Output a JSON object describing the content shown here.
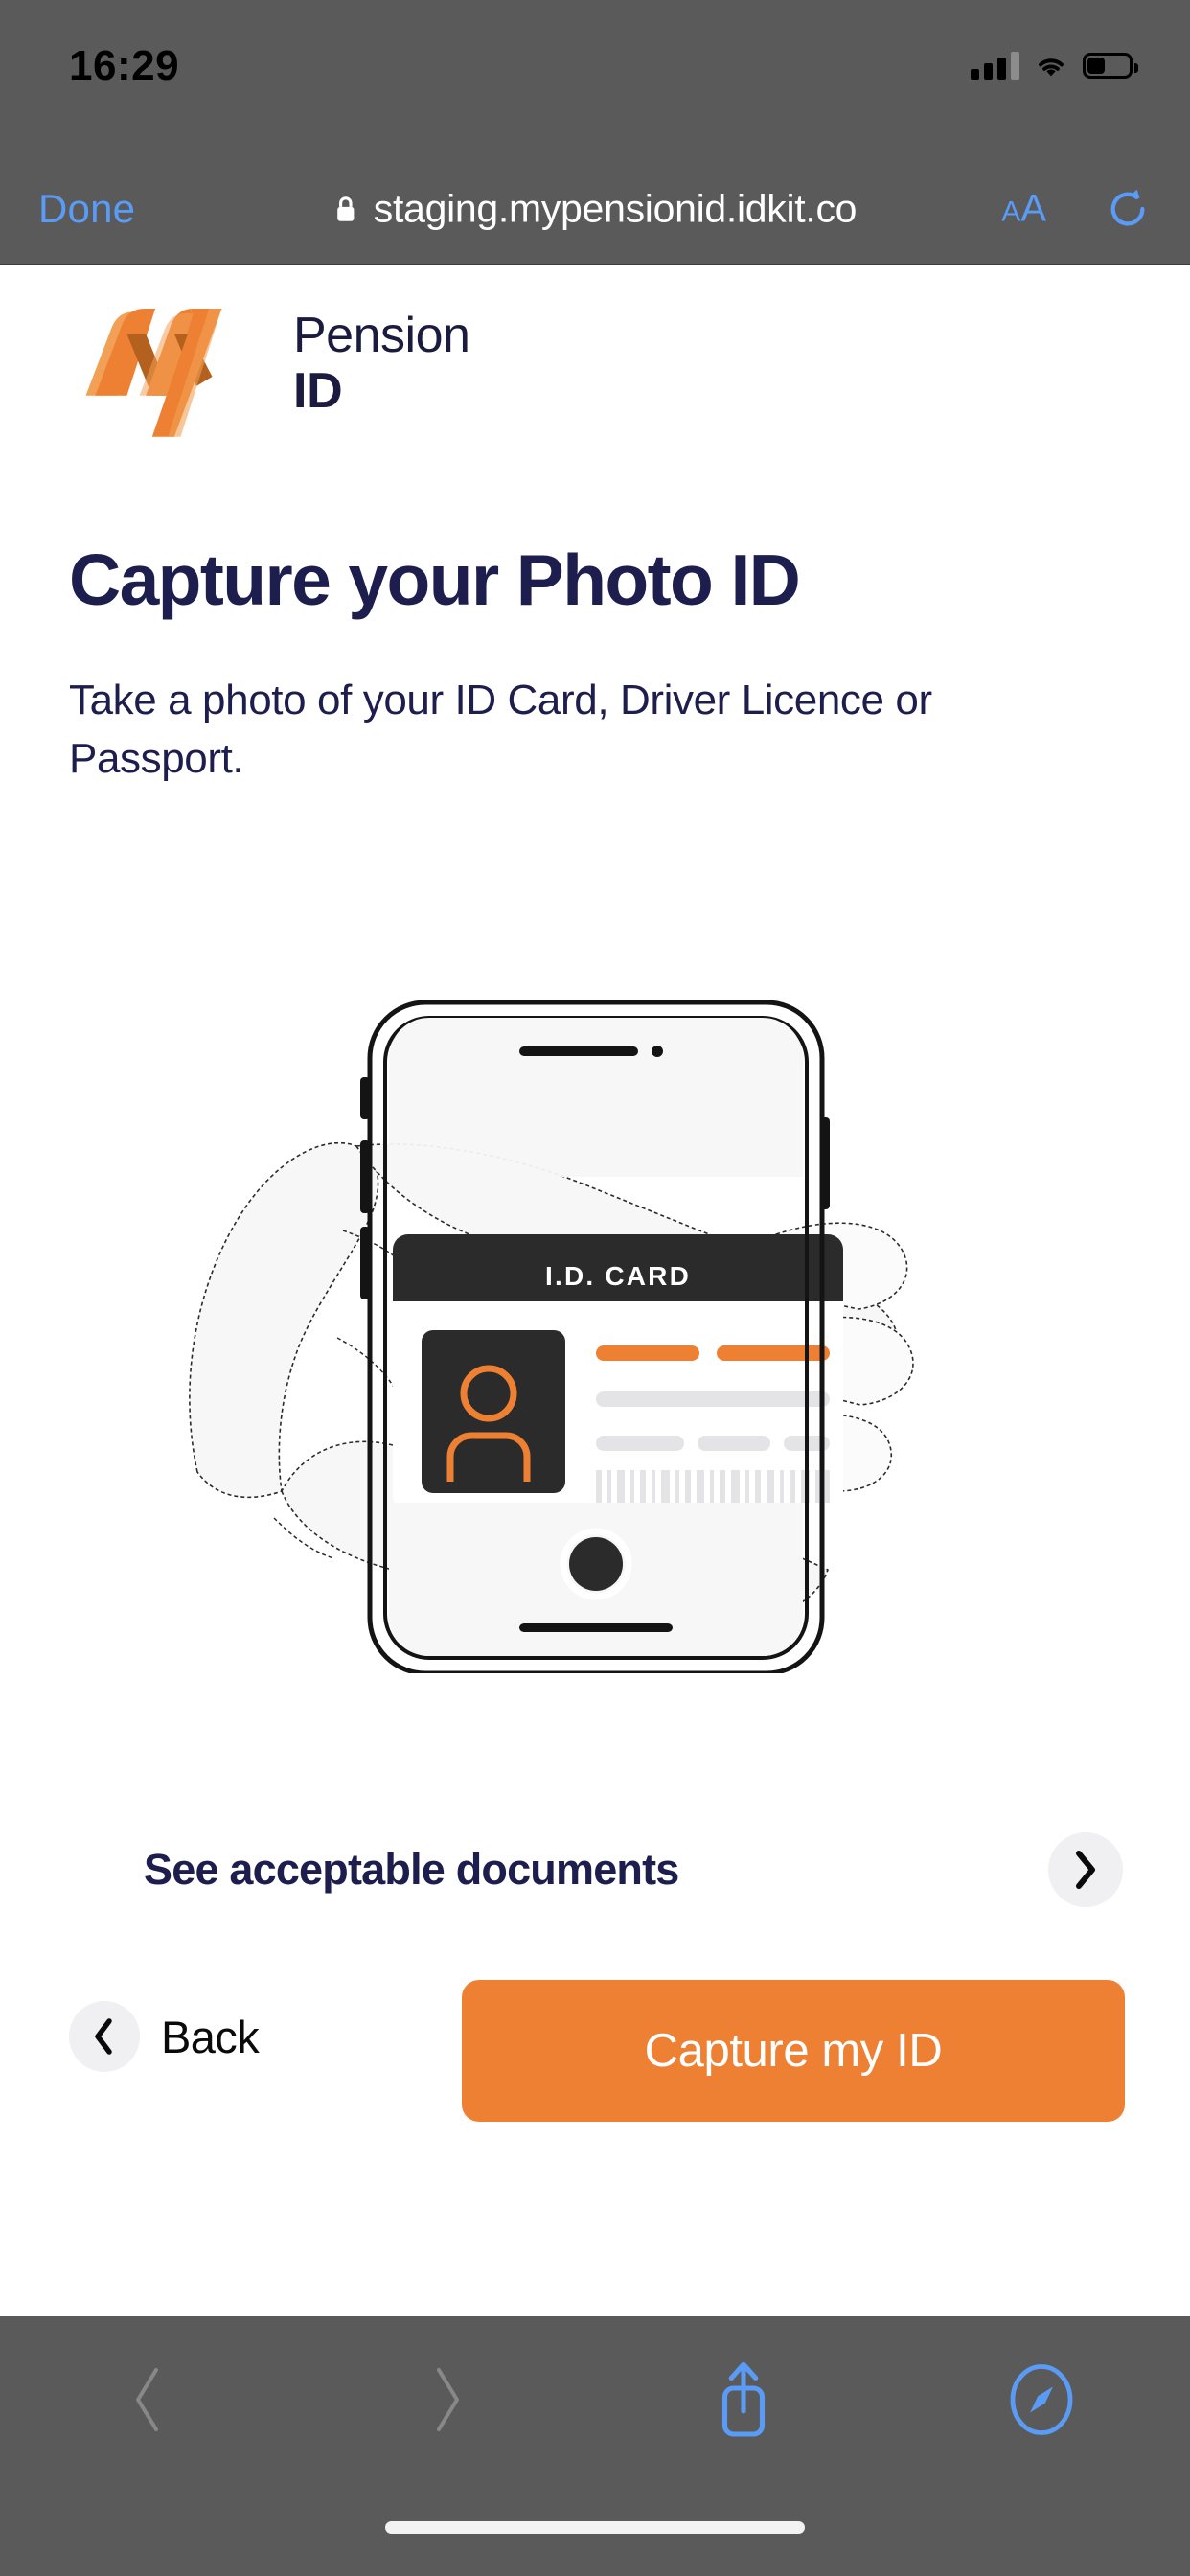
{
  "status_bar": {
    "time": "16:29",
    "signal_icon": "cellular-signal-icon",
    "wifi_icon": "wifi-icon",
    "battery_icon": "battery-icon",
    "battery_level_percent": 40
  },
  "browser": {
    "done_label": "Done",
    "lock_icon": "lock-icon",
    "url": "staging.mypensionid.idkit.co",
    "text_size_label_small": "A",
    "text_size_label_large": "A",
    "reload_icon": "reload-icon",
    "bottom": {
      "back_icon": "chevron-left-icon",
      "forward_icon": "chevron-right-icon",
      "share_icon": "share-icon",
      "tabs_icon": "safari-compass-icon",
      "back_enabled": false,
      "forward_enabled": false
    }
  },
  "brand": {
    "logo_mark": "my-pension-id-logo-mark",
    "name_line1": "Pension",
    "name_line2": "ID",
    "orange": "#ee8033",
    "orange_dark": "#b4601f",
    "orange_light": "#f2a055",
    "navy": "#1d1e4e"
  },
  "page": {
    "heading": "Capture your Photo ID",
    "subtitle": "Take a photo of your ID Card, Driver Licence or Passport.",
    "illustration": {
      "name": "hand-holding-phone-with-id-card-illustration",
      "phone_screen_card_title": "I.D. CARD",
      "shutter_button": "camera-shutter-button"
    },
    "documents_link": {
      "label": "See acceptable documents",
      "chevron_icon": "chevron-right-icon"
    },
    "back_button": {
      "label": "Back",
      "icon": "chevron-left-icon"
    },
    "primary_button": {
      "label": "Capture my ID"
    }
  }
}
